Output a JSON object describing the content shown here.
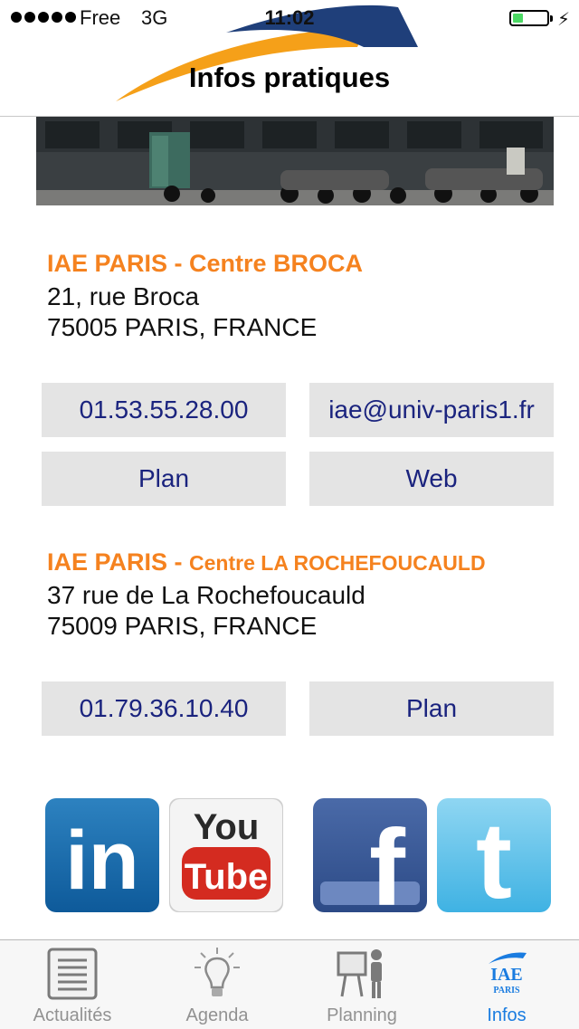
{
  "status_bar": {
    "carrier": "Free",
    "network": "3G",
    "time": "11:02",
    "battery_level": 0.3
  },
  "nav": {
    "title": "Infos pratiques"
  },
  "campuses": [
    {
      "name_prefix": "IAE PARIS - ",
      "name_suffix": "Centre BROCA",
      "address_line1": "21, rue Broca",
      "address_line2": "75005 PARIS, FRANCE",
      "buttons": [
        "01.53.55.28.00",
        "iae@univ-paris1.fr",
        "Plan",
        "Web"
      ]
    },
    {
      "name_prefix": "IAE PARIS - ",
      "name_suffix": "Centre LA ROCHEFOUCAULD",
      "address_line1": "37 rue de La Rochefoucauld",
      "address_line2": "75009 PARIS, FRANCE",
      "buttons": [
        "01.79.36.10.40",
        "Plan"
      ]
    }
  ],
  "social": [
    {
      "icon": "linkedin-icon",
      "text": "in"
    },
    {
      "icon": "youtube-icon",
      "text_top": "You",
      "text_bottom": "Tube"
    },
    {
      "icon": "facebook-icon",
      "text": "f"
    },
    {
      "icon": "twitter-icon",
      "text": "t"
    }
  ],
  "tabbar": {
    "tabs": [
      {
        "label": "Actualités",
        "icon": "news-icon",
        "active": false
      },
      {
        "label": "Agenda",
        "icon": "lightbulb-icon",
        "active": false
      },
      {
        "label": "Planning",
        "icon": "planning-icon",
        "active": false
      },
      {
        "label": "Infos",
        "icon": "iae-logo-icon",
        "active": true
      }
    ]
  },
  "colors": {
    "accent_orange": "#f5821f",
    "link_navy": "#1a237e",
    "button_gray": "#e4e4e4",
    "tab_active": "#1a7ce0",
    "tab_inactive": "#929292"
  }
}
